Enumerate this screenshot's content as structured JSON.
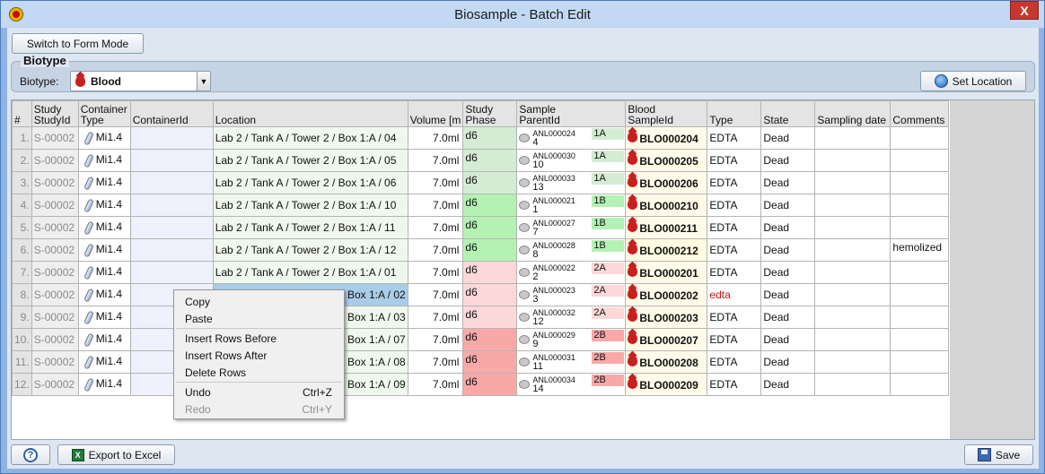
{
  "window": {
    "title": "Biosample - Batch Edit",
    "close_label": "X"
  },
  "toolbar": {
    "switch_label": "Switch to Form Mode"
  },
  "biotype_panel": {
    "legend": "Biotype",
    "label": "Biotype:",
    "selected": "Blood",
    "set_location_label": "Set Location"
  },
  "columns": [
    {
      "line1": "",
      "line2": "#"
    },
    {
      "line1": "Study",
      "line2": "StudyId"
    },
    {
      "line1": "Container",
      "line2": "Type"
    },
    {
      "line1": "",
      "line2": "ContainerId"
    },
    {
      "line1": "",
      "line2": "Location"
    },
    {
      "line1": "",
      "line2": "Volume [m"
    },
    {
      "line1": "Study",
      "line2": "Phase"
    },
    {
      "line1": "Sample",
      "line2": "ParentId"
    },
    {
      "line1": "Blood",
      "line2": "SampleId"
    },
    {
      "line1": "",
      "line2": "Type"
    },
    {
      "line1": "",
      "line2": "State"
    },
    {
      "line1": "",
      "line2": "Sampling date"
    },
    {
      "line1": "",
      "line2": "Comments"
    }
  ],
  "rows": [
    {
      "n": "1.",
      "study": "S-00002",
      "ctype": "Mi1.4",
      "cid": "",
      "location": "Lab 2 / Tank A / Tower 2 / Box 1:A / 04",
      "volume": "7.0ml",
      "phase": "d6",
      "parent_id": "ANL000024",
      "parent_num": "4",
      "parent_badge": "1A",
      "sample_id": "BLO000204",
      "type": "EDTA",
      "state": "Dead",
      "date": "",
      "comment": ""
    },
    {
      "n": "2.",
      "study": "S-00002",
      "ctype": "Mi1.4",
      "cid": "",
      "location": "Lab 2 / Tank A / Tower 2 / Box 1:A / 05",
      "volume": "7.0ml",
      "phase": "d6",
      "parent_id": "ANL000030",
      "parent_num": "10",
      "parent_badge": "1A",
      "sample_id": "BLO000205",
      "type": "EDTA",
      "state": "Dead",
      "date": "",
      "comment": ""
    },
    {
      "n": "3.",
      "study": "S-00002",
      "ctype": "Mi1.4",
      "cid": "",
      "location": "Lab 2 / Tank A / Tower 2 / Box 1:A / 06",
      "volume": "7.0ml",
      "phase": "d6",
      "parent_id": "ANL000033",
      "parent_num": "13",
      "parent_badge": "1A",
      "sample_id": "BLO000206",
      "type": "EDTA",
      "state": "Dead",
      "date": "",
      "comment": ""
    },
    {
      "n": "4.",
      "study": "S-00002",
      "ctype": "Mi1.4",
      "cid": "",
      "location": "Lab 2 / Tank A / Tower 2 / Box 1:A / 10",
      "volume": "7.0ml",
      "phase": "d6",
      "parent_id": "ANL000021",
      "parent_num": "1",
      "parent_badge": "1B",
      "sample_id": "BLO000210",
      "type": "EDTA",
      "state": "Dead",
      "date": "",
      "comment": ""
    },
    {
      "n": "5.",
      "study": "S-00002",
      "ctype": "Mi1.4",
      "cid": "",
      "location": "Lab 2 / Tank A / Tower 2 / Box 1:A / 11",
      "volume": "7.0ml",
      "phase": "d6",
      "parent_id": "ANL000027",
      "parent_num": "7",
      "parent_badge": "1B",
      "sample_id": "BLO000211",
      "type": "EDTA",
      "state": "Dead",
      "date": "",
      "comment": ""
    },
    {
      "n": "6.",
      "study": "S-00002",
      "ctype": "Mi1.4",
      "cid": "",
      "location": "Lab 2 / Tank A / Tower 2 / Box 1:A / 12",
      "volume": "7.0ml",
      "phase": "d6",
      "parent_id": "ANL000028",
      "parent_num": "8",
      "parent_badge": "1B",
      "sample_id": "BLO000212",
      "type": "EDTA",
      "state": "Dead",
      "date": "",
      "comment": "hemolized"
    },
    {
      "n": "7.",
      "study": "S-00002",
      "ctype": "Mi1.4",
      "cid": "",
      "location": "Lab 2 / Tank A / Tower 2 / Box 1:A / 01",
      "volume": "7.0ml",
      "phase": "d6",
      "parent_id": "ANL000022",
      "parent_num": "2",
      "parent_badge": "2A",
      "sample_id": "BLO000201",
      "type": "EDTA",
      "state": "Dead",
      "date": "",
      "comment": ""
    },
    {
      "n": "8.",
      "study": "S-00002",
      "ctype": "Mi1.4",
      "cid": "",
      "location": "Box 1:A / 02",
      "volume": "7.0ml",
      "phase": "d6",
      "parent_id": "ANL000023",
      "parent_num": "3",
      "parent_badge": "2A",
      "sample_id": "BLO000202",
      "type": "edta",
      "state": "Dead",
      "date": "",
      "comment": ""
    },
    {
      "n": "9.",
      "study": "S-00002",
      "ctype": "Mi1.4",
      "cid": "",
      "location": "Box 1:A / 03",
      "volume": "7.0ml",
      "phase": "d6",
      "parent_id": "ANL000032",
      "parent_num": "12",
      "parent_badge": "2A",
      "sample_id": "BLO000203",
      "type": "EDTA",
      "state": "Dead",
      "date": "",
      "comment": ""
    },
    {
      "n": "10.",
      "study": "S-00002",
      "ctype": "Mi1.4",
      "cid": "",
      "location": "Box 1:A / 07",
      "volume": "7.0ml",
      "phase": "d6",
      "parent_id": "ANL000029",
      "parent_num": "9",
      "parent_badge": "2B",
      "sample_id": "BLO000207",
      "type": "EDTA",
      "state": "Dead",
      "date": "",
      "comment": ""
    },
    {
      "n": "11.",
      "study": "S-00002",
      "ctype": "Mi1.4",
      "cid": "",
      "location": "Box 1:A / 08",
      "volume": "7.0ml",
      "phase": "d6",
      "parent_id": "ANL000031",
      "parent_num": "11",
      "parent_badge": "2B",
      "sample_id": "BLO000208",
      "type": "EDTA",
      "state": "Dead",
      "date": "",
      "comment": ""
    },
    {
      "n": "12.",
      "study": "S-00002",
      "ctype": "Mi1.4",
      "cid": "",
      "location": "Box 1:A / 09",
      "volume": "7.0ml",
      "phase": "d6",
      "parent_id": "ANL000034",
      "parent_num": "14",
      "parent_badge": "2B",
      "sample_id": "BLO000209",
      "type": "EDTA",
      "state": "Dead",
      "date": "",
      "comment": ""
    }
  ],
  "group_colors": {
    "1A": "#d4ecd4",
    "1B": "#b3f2b3",
    "2A": "#fcd8d8",
    "2B": "#f9a8a8"
  },
  "highlight_sample": "#fffbe0",
  "context_menu": {
    "copy": "Copy",
    "paste": "Paste",
    "insert_before": "Insert Rows Before",
    "insert_after": "Insert Rows After",
    "delete_rows": "Delete Rows",
    "undo": "Undo",
    "undo_shortcut": "Ctrl+Z",
    "redo": "Redo",
    "redo_shortcut": "Ctrl+Y"
  },
  "footer": {
    "help_label": "?",
    "export_label": "Export to Excel",
    "export_icon_text": "X",
    "save_label": "Save"
  }
}
